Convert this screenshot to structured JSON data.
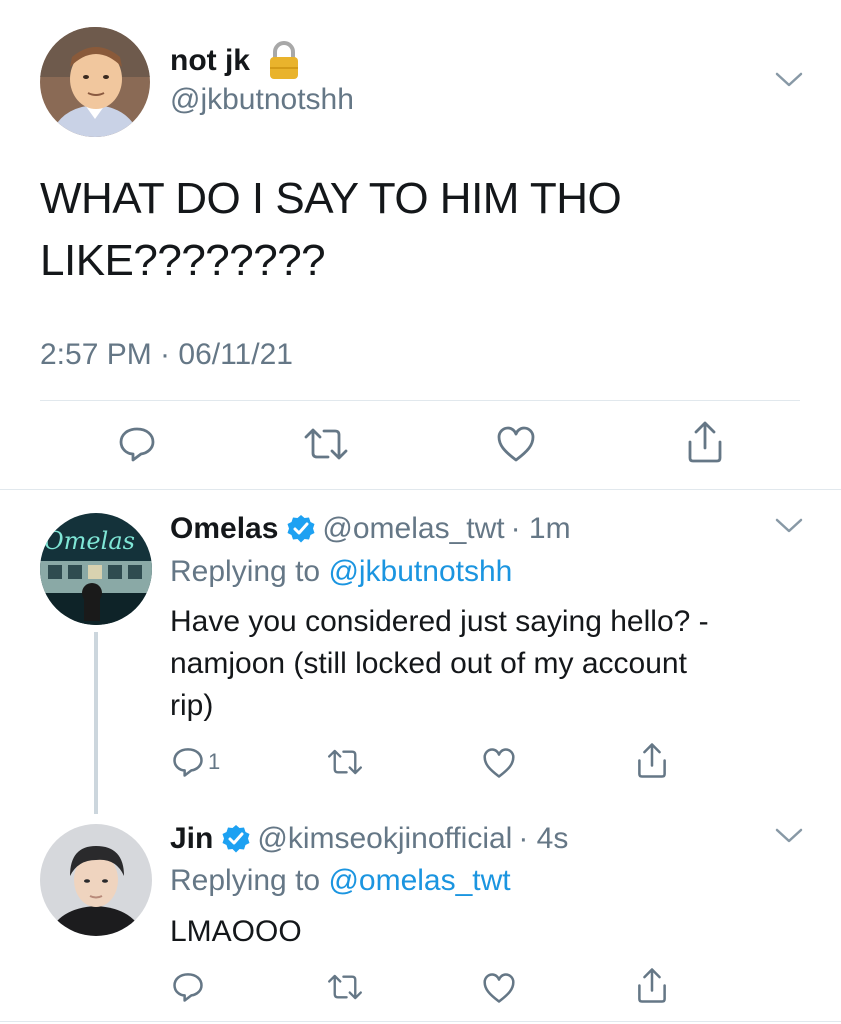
{
  "main_tweet": {
    "author_name": "not jk",
    "author_handle": "@jkbutnotshh",
    "text_line1": "WHAT DO I SAY TO HIM THO",
    "text_line2": "LIKE????????",
    "timestamp": "2:57 PM · 06/11/21"
  },
  "replies": [
    {
      "author_name": "Omelas",
      "author_handle": "@omelas_twt",
      "time": "· 1m",
      "replying_to_prefix": "Replying to ",
      "replying_to_handle": "@jkbutnotshh",
      "text_line1": "Have you considered just saying hello? -",
      "text_line2": "namjoon (still locked out of my account",
      "text_line3": "rip)",
      "reply_count": "1",
      "avatar_text": "Omelas"
    },
    {
      "author_name": "Jin",
      "author_handle": "@kimseokjinofficial",
      "time": "· 4s",
      "replying_to_prefix": "Replying to ",
      "replying_to_handle": "@omelas_twt",
      "text_line1": "LMAOOO"
    }
  ],
  "colors": {
    "accent": "#1b95e0",
    "secondary_text": "#657786",
    "verified": "#1da1f2",
    "divider": "#e1e8ed"
  },
  "icons": [
    "lock-icon",
    "chevron-down-icon",
    "reply-icon",
    "retweet-icon",
    "like-icon",
    "share-icon",
    "verified-badge-icon"
  ]
}
